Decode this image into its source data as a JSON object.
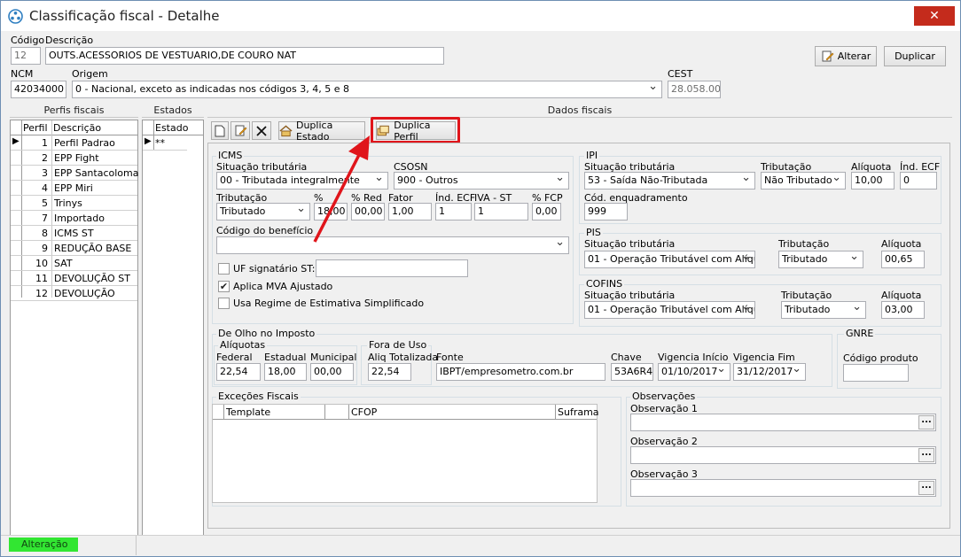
{
  "window": {
    "title": "Classificação fiscal - Detalhe",
    "close_label": "✕"
  },
  "header": {
    "codigo_label": "Código",
    "codigo_value": "12",
    "descricao_label": "Descrição",
    "descricao_value": "OUTS.ACESSORIOS DE VESTUARIO,DE COURO NAT",
    "ncm_label": "NCM",
    "ncm_value": "42034000",
    "origem_label": "Origem",
    "origem_value": "0 - Nacional, exceto as indicadas nos códigos 3, 4, 5 e 8",
    "cest_label": "CEST",
    "cest_value": "28.058.00",
    "alterar_label": "Alterar",
    "duplicar_label": "Duplicar"
  },
  "perfis": {
    "title": "Perfis fiscais",
    "col_perfil": "Perfil",
    "col_descricao": "Descrição",
    "rows": [
      {
        "num": "1",
        "desc": "Perfil Padrao"
      },
      {
        "num": "2",
        "desc": "EPP Fight"
      },
      {
        "num": "3",
        "desc": "EPP Santacoloma"
      },
      {
        "num": "4",
        "desc": "EPP Miri"
      },
      {
        "num": "5",
        "desc": "Trinys"
      },
      {
        "num": "7",
        "desc": "Importado"
      },
      {
        "num": "8",
        "desc": "ICMS ST"
      },
      {
        "num": "9",
        "desc": "REDUÇÃO BASE"
      },
      {
        "num": "10",
        "desc": "SAT"
      },
      {
        "num": "11",
        "desc": "DEVOLUÇÃO ST"
      },
      {
        "num": "12",
        "desc": "DEVOLUÇÃO"
      }
    ]
  },
  "estados": {
    "title": "Estados",
    "col_estado": "Estado",
    "row_value": "**"
  },
  "dados": {
    "title": "Dados fiscais",
    "duplica_estado": "Duplica Estado",
    "duplica_perfil": "Duplica Perfil",
    "icms": {
      "title": "ICMS",
      "sit_trib_label": "Situação tributária",
      "sit_trib_value": "00 - Tributada integralmente",
      "csosn_label": "CSOSN",
      "csosn_value": "900 - Outros",
      "tributacao_label": "Tributação",
      "tributacao_value": "Tributado",
      "pct_label": "%",
      "pct_value": "18,00",
      "pct_red_label": "% Red",
      "pct_red_value": "00,00",
      "fator_label": "Fator",
      "fator_value": "1,00",
      "ind_ecf_label": "Índ. ECF",
      "ind_ecf_value": "1",
      "iva_st_label": "IVA - ST",
      "iva_st_value": "1",
      "fcp_label": "% FCP",
      "fcp_value": "0,00",
      "beneficio_label": "Código do benefício",
      "beneficio_value": "",
      "uf_sig_label": "UF signatário ST:",
      "uf_sig_value": "",
      "mva_label": "Aplica MVA Ajustado",
      "mva_check": "✔",
      "regime_label": "Usa Regime de Estimativa Simplificado"
    },
    "ipi": {
      "title": "IPI",
      "sit_trib_label": "Situação tributária",
      "sit_trib_value": "53 - Saída Não-Tributada",
      "tributacao_label": "Tributação",
      "tributacao_value": "Não Tributado",
      "aliquota_label": "Alíquota",
      "aliquota_value": "10,00",
      "ind_ecf_label": "Índ. ECF",
      "ind_ecf_value": "0",
      "enq_label": "Cód. enquadramento",
      "enq_value": "999"
    },
    "pis": {
      "title": "PIS",
      "sit_trib_label": "Situação tributária",
      "sit_trib_value": "01 - Operação Tributável com Alíqu",
      "tributacao_label": "Tributação",
      "tributacao_value": "Tributado",
      "aliquota_label": "Alíquota",
      "aliquota_value": "00,65"
    },
    "cofins": {
      "title": "COFINS",
      "sit_trib_label": "Situação tributária",
      "sit_trib_value": "01 - Operação Tributável com Alíqu",
      "tributacao_label": "Tributação",
      "tributacao_value": "Tributado",
      "aliquota_label": "Alíquota",
      "aliquota_value": "03,00"
    },
    "olho": {
      "title": "De Olho no Imposto",
      "aliquotas_label": "Alíquotas",
      "federal_label": "Federal",
      "federal_value": "22,54",
      "estadual_label": "Estadual",
      "estadual_value": "18,00",
      "municipal_label": "Municipal",
      "municipal_value": "00,00",
      "fora_label": "Fora de Uso",
      "aliq_total_label": "Aliq Totalizada",
      "aliq_total_value": "22,54",
      "fonte_label": "Fonte",
      "fonte_value": "IBPT/empresometro.com.br",
      "chave_label": "Chave",
      "chave_value": "53A6R4",
      "vig_ini_label": "Vigencia Início",
      "vig_ini_value": "01/10/2017",
      "vig_fim_label": "Vigencia Fim",
      "vig_fim_value": "31/12/2017"
    },
    "gnre": {
      "title": "GNRE",
      "codigo_label": "Código produto",
      "codigo_value": ""
    },
    "excecoes": {
      "title": "Exceções Fiscais",
      "col_template": "Template",
      "col_cfop": "CFOP",
      "col_suframa": "Suframa"
    },
    "obs": {
      "title": "Observações",
      "obs1_label": "Observação 1",
      "obs2_label": "Observação 2",
      "obs3_label": "Observação 3",
      "ellipsis": "..."
    }
  },
  "status": {
    "mode": "Alteração"
  },
  "colors": {
    "highlight": "#e0151b",
    "status_green": "#32e632"
  }
}
